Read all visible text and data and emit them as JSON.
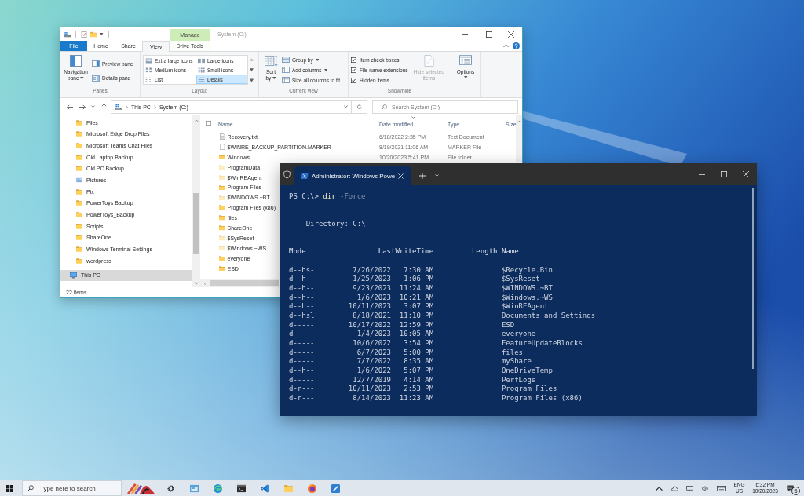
{
  "explorer": {
    "title": "System (C:)",
    "contextual_group": "Manage",
    "tabs": [
      {
        "label": "File",
        "kind": "file",
        "selected": false
      },
      {
        "label": "Home",
        "kind": "tab",
        "selected": false
      },
      {
        "label": "Share",
        "kind": "tab",
        "selected": false
      },
      {
        "label": "View",
        "kind": "tab",
        "selected": true
      },
      {
        "label": "Drive Tools",
        "kind": "contextual",
        "selected": false
      }
    ],
    "ribbon": {
      "panes": {
        "label": "Panes",
        "navigation_pane": "Navigation pane",
        "preview_pane": "Preview pane",
        "details_pane": "Details pane"
      },
      "layout": {
        "label": "Layout",
        "options": [
          {
            "label": "Extra large icons",
            "kind": "xlarge",
            "selected": false
          },
          {
            "label": "Large icons",
            "kind": "large",
            "selected": false
          },
          {
            "label": "Medium icons",
            "kind": "medium",
            "selected": false
          },
          {
            "label": "Small icons",
            "kind": "small",
            "selected": false
          },
          {
            "label": "List",
            "kind": "list",
            "selected": false
          },
          {
            "label": "Details",
            "kind": "details",
            "selected": true
          }
        ]
      },
      "current_view": {
        "label": "Current view",
        "sort_by": "Sort by",
        "group_by": "Group by",
        "add_columns": "Add columns",
        "size_columns": "Size all columns to fit"
      },
      "show_hide": {
        "label": "Show/hide",
        "checkboxes": [
          {
            "label": "Item check boxes",
            "checked": true
          },
          {
            "label": "File name extensions",
            "checked": true
          },
          {
            "label": "Hidden items",
            "checked": true
          }
        ],
        "hide_selected": {
          "label": "Hide selected items",
          "disabled": true
        }
      },
      "options": {
        "label": "Options"
      }
    },
    "address": {
      "crumbs": [
        "This PC",
        "System (C:)"
      ],
      "search_placeholder": "Search System (C:)"
    },
    "nav_pane": {
      "items": [
        {
          "label": "Files",
          "kind": "folder",
          "selected": false
        },
        {
          "label": "Microsoft Edge Drop Files",
          "kind": "folder",
          "selected": false
        },
        {
          "label": "Microsoft Teams Chat Files",
          "kind": "folder",
          "selected": false
        },
        {
          "label": "Old Laptop Backup",
          "kind": "folder",
          "selected": false
        },
        {
          "label": "Old PC Backup",
          "kind": "folder",
          "selected": false
        },
        {
          "label": "Pictures",
          "kind": "pictures",
          "selected": false
        },
        {
          "label": "Pix",
          "kind": "folder",
          "selected": false
        },
        {
          "label": "PowerToys Backup",
          "kind": "folder",
          "selected": false
        },
        {
          "label": "PowerToys_Backup",
          "kind": "folder",
          "selected": false
        },
        {
          "label": "Scripts",
          "kind": "folder",
          "selected": false
        },
        {
          "label": "ShareOne",
          "kind": "folder",
          "selected": false
        },
        {
          "label": "Windows Terminal Settings",
          "kind": "folder",
          "selected": false
        },
        {
          "label": "wordpress",
          "kind": "folder",
          "selected": false
        },
        {
          "label": "This PC",
          "kind": "pc",
          "selected": true
        }
      ]
    },
    "file_list": {
      "select_all": {
        "checked": false
      },
      "columns": [
        {
          "label": "Name",
          "sorted": false
        },
        {
          "label": "Date modified",
          "sorted": true
        },
        {
          "label": "Type",
          "sorted": false
        },
        {
          "label": "Size",
          "sorted": false
        }
      ],
      "rows": [
        {
          "name": "Recovery.txt",
          "kind": "text",
          "hidden": false,
          "date": "6/18/2022 2:35 PM",
          "type": "Text Document"
        },
        {
          "name": "$WINRE_BACKUP_PARTITION.MARKER",
          "kind": "file",
          "hidden": false,
          "date": "8/19/2021 11:06 AM",
          "type": "MARKER File"
        },
        {
          "name": "Windows",
          "kind": "folder",
          "hidden": false,
          "date": "10/20/2023 5:41 PM",
          "type": "File folder"
        },
        {
          "name": "ProgramData",
          "kind": "folder",
          "hidden": true
        },
        {
          "name": "$WinREAgent",
          "kind": "folder",
          "hidden": true
        },
        {
          "name": "Program Files",
          "kind": "folder",
          "hidden": false
        },
        {
          "name": "$WINDOWS.~BT",
          "kind": "folder",
          "hidden": true
        },
        {
          "name": "Program Files (x86)",
          "kind": "folder",
          "hidden": false
        },
        {
          "name": "files",
          "kind": "folder",
          "hidden": false
        },
        {
          "name": "ShareOne",
          "kind": "folder",
          "hidden": false
        },
        {
          "name": "$SysReset",
          "kind": "folder",
          "hidden": true
        },
        {
          "name": "$Windows.~WS",
          "kind": "folder",
          "hidden": true
        },
        {
          "name": "everyone",
          "kind": "folder",
          "hidden": false
        },
        {
          "name": "ESD",
          "kind": "folder",
          "hidden": false
        }
      ]
    },
    "status": "22 items"
  },
  "terminal": {
    "tab_title": "Administrator: Windows Powe",
    "prompt": "PS C:\\>",
    "command": "dir",
    "parameter": "-Force",
    "directory": "Directory: C:\\",
    "headers": [
      "Mode",
      "LastWriteTime",
      "Length",
      "Name"
    ],
    "rules": [
      "----",
      "-------------",
      "------",
      "----"
    ],
    "rows": [
      {
        "mode": "d--hs-",
        "date": "7/26/2022",
        "time": "7:30 AM",
        "name": "$Recycle.Bin"
      },
      {
        "mode": "d--h--",
        "date": "1/25/2023",
        "time": "1:06 PM",
        "name": "$SysReset"
      },
      {
        "mode": "d--h--",
        "date": "9/23/2023",
        "time": "11:24 AM",
        "name": "$WINDOWS.~BT"
      },
      {
        "mode": "d--h--",
        "date": "1/6/2023",
        "time": "10:21 AM",
        "name": "$Windows.~WS"
      },
      {
        "mode": "d--h--",
        "date": "10/11/2023",
        "time": "3:07 PM",
        "name": "$WinREAgent"
      },
      {
        "mode": "d--hsl",
        "date": "8/18/2021",
        "time": "11:10 PM",
        "name": "Documents and Settings"
      },
      {
        "mode": "d-----",
        "date": "10/17/2022",
        "time": "12:59 PM",
        "name": "ESD"
      },
      {
        "mode": "d-----",
        "date": "1/4/2023",
        "time": "10:05 AM",
        "name": "everyone"
      },
      {
        "mode": "d-----",
        "date": "10/6/2022",
        "time": "3:54 PM",
        "name": "FeatureUpdateBlocks"
      },
      {
        "mode": "d-----",
        "date": "6/7/2023",
        "time": "5:00 PM",
        "name": "files"
      },
      {
        "mode": "d-----",
        "date": "7/7/2022",
        "time": "8:35 AM",
        "name": "myShare"
      },
      {
        "mode": "d--h--",
        "date": "1/6/2022",
        "time": "5:07 PM",
        "name": "OneDriveTemp"
      },
      {
        "mode": "d-----",
        "date": "12/7/2019",
        "time": "4:14 AM",
        "name": "PerfLogs"
      },
      {
        "mode": "d-r---",
        "date": "10/11/2023",
        "time": "2:53 PM",
        "name": "Program Files"
      },
      {
        "mode": "d-r---",
        "date": "8/14/2023",
        "time": "11:23 AM",
        "name": "Program Files (x86)"
      }
    ]
  },
  "taskbar": {
    "search_placeholder": "Type here to search",
    "language": "ENG",
    "region": "US",
    "time": "6:32 PM",
    "date": "10/20/2023",
    "notification_count": "5"
  }
}
